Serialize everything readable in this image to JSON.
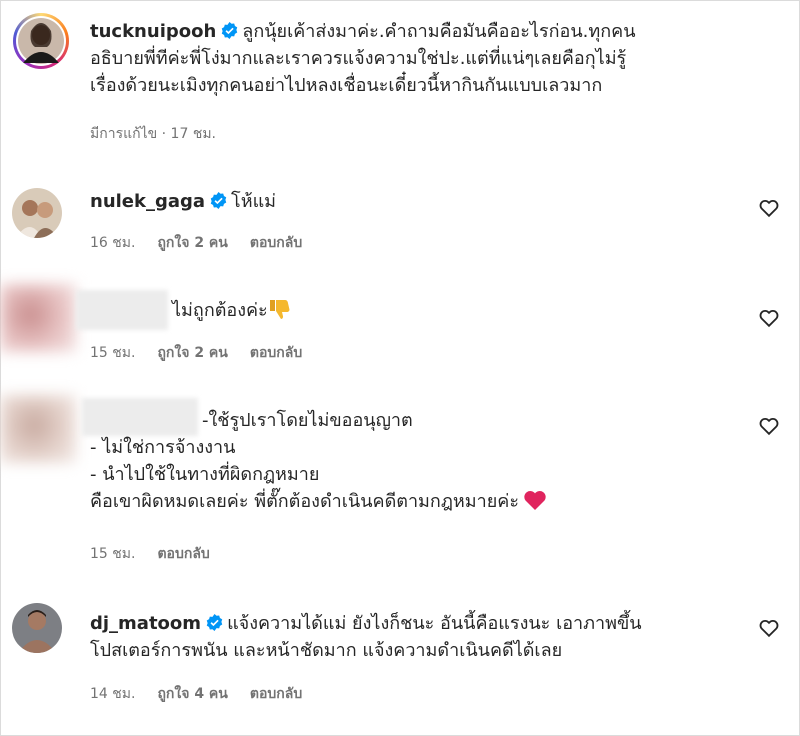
{
  "post": {
    "username": "tucknuipooh",
    "caption_lines": [
      "ลูกนุ้ยเค้าส่งมาค่ะ.คำถามคือมันคืออะไรก่อน.ทุกคน",
      "อธิบายพี่ทีค่ะพี่โง่มากและเราควรแจ้งความใช่ปะ.แต่ที่แน่ๆเลยคือกุไม่รู้",
      "เรื่องด้วยนะเมิงทุกคนอย่าไปหลงเชื่อนะเดี๋ยวนี้หากินกันแบบเลวมาก"
    ],
    "edited": "มีการแก้ไข · 17 ชม."
  },
  "comments": [
    {
      "username": "nulek_gaga",
      "text": "โห้แม่",
      "time": "16 ชม.",
      "likes": "ถูกใจ 2 คน",
      "reply": "ตอบกลับ"
    },
    {
      "username": "",
      "text": "ไม่ถูกต้องค่ะ",
      "emoji": "thumbs-down",
      "time": "15 ชม.",
      "likes": "ถูกใจ 2 คน",
      "reply": "ตอบกลับ"
    },
    {
      "username": "",
      "text_lines": [
        "-ใช้รูปเราโดยไม่ขออนุญาต",
        "- ไม่ใช่การจ้างงาน",
        "- นำไปใช้ในทางที่ผิดกฎหมาย",
        "คือเขาผิดหมดเลยค่ะ พี่ตั๊กต้องดำเนินคดีตามกฎหมายค่ะ"
      ],
      "emoji": "red-heart",
      "time": "15 ชม.",
      "reply": "ตอบกลับ"
    },
    {
      "username": "dj_matoom",
      "text_lines": [
        "แจ้งความได้แม่ ยังไงก็ชนะ อันนี้คือแรงนะ เอาภาพขึ้น",
        "โปสเตอร์การพนัน และหน้าชัดมาก แจ้งความดำเนินคดีได้เลย"
      ],
      "time": "14 ชม.",
      "likes": "ถูกใจ 4 คน",
      "reply": "ตอบกลับ"
    }
  ],
  "colors": {
    "verified": "#0095f6",
    "meta": "#737373",
    "heart_emoji": "#e0245e",
    "thumb_emoji": "#f5b82e"
  }
}
